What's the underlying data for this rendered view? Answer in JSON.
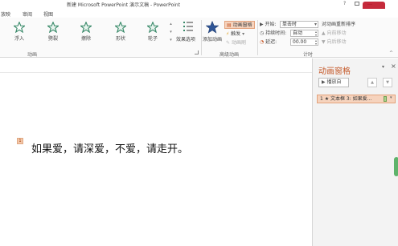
{
  "window": {
    "title": "新建 Microsoft PowerPoint 演示文稿 - PowerPoint",
    "help": "?"
  },
  "tabs": [
    "放映",
    "审阅",
    "视图"
  ],
  "ribbon": {
    "animations": [
      {
        "label": "浮入",
        "icon": "float-in-star-icon"
      },
      {
        "label": "劈裂",
        "icon": "split-star-icon"
      },
      {
        "label": "擦除",
        "icon": "wipe-star-icon"
      },
      {
        "label": "形状",
        "icon": "shape-star-icon"
      },
      {
        "label": "轮子",
        "icon": "wheel-star-icon"
      }
    ],
    "effect_options": "效果选项",
    "group_animation": "动画",
    "add_animation": "添加动画",
    "animation_pane": "动画窗格",
    "trigger": "触发",
    "animation_painter": "动画刷",
    "group_advanced": "高级动画",
    "start_label": "开始:",
    "start_value": "单击时",
    "duration_label": "持续时间:",
    "duration_value": "自动",
    "delay_label": "延迟:",
    "delay_value": "00.00",
    "reorder_label": "对动画重新排序",
    "move_earlier": "向前移动",
    "move_later": "向后移动",
    "group_timing": "计时"
  },
  "pane": {
    "title": "动画窗格",
    "play_from": "播放自",
    "item_label": "1 ★ 文本框 3: 如果爱..."
  },
  "slide": {
    "sequence_number": "1",
    "text": "如果爱，请深爱，不爱，请走开。"
  },
  "colors": {
    "accent": "#c55a2b",
    "star_green": "#3a8a6a",
    "add_star_blue": "#2f5597"
  }
}
